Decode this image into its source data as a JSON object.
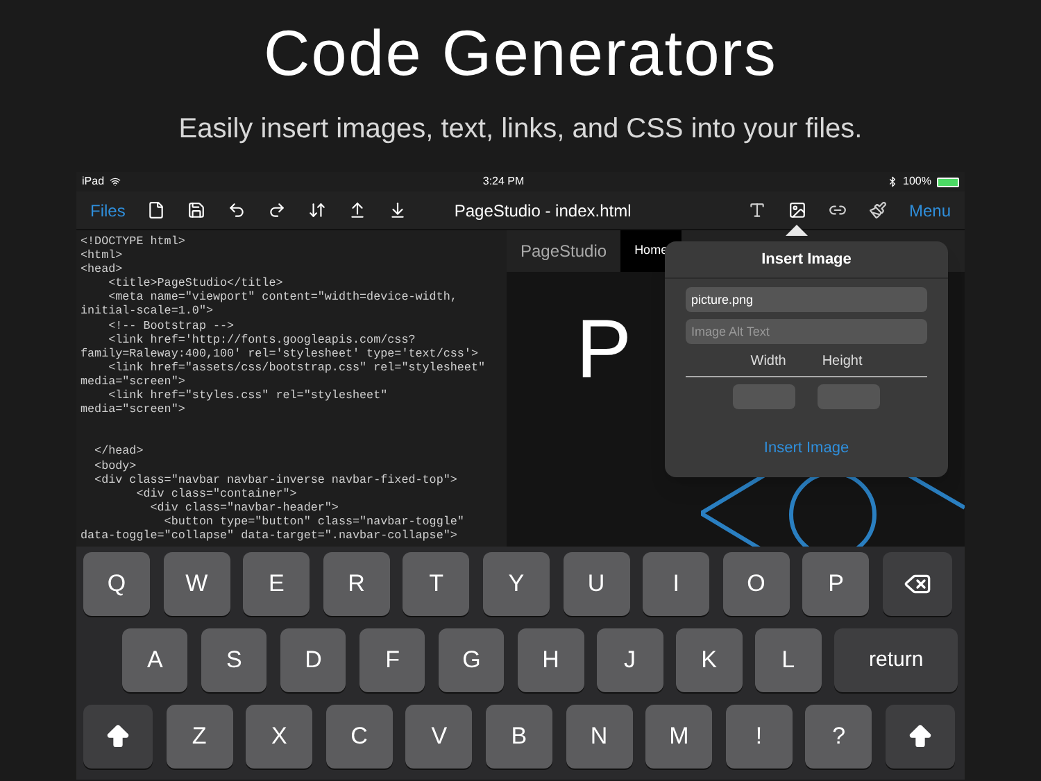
{
  "headline": "Code Generators",
  "subheadline": "Easily insert images, text, links, and CSS into your files.",
  "status_bar": {
    "device": "iPad",
    "time": "3:24 PM",
    "battery": "100%"
  },
  "toolbar": {
    "files": "Files",
    "title": "PageStudio - index.html",
    "menu": "Menu",
    "tools": [
      {
        "kind": "text",
        "selected": false
      },
      {
        "kind": "image",
        "selected": true
      },
      {
        "kind": "link",
        "selected": false
      },
      {
        "kind": "css",
        "selected": false
      }
    ]
  },
  "code_lines": [
    "<!DOCTYPE html>",
    "<html>",
    "<head>",
    "    <title>PageStudio</title>",
    "    <meta name=\"viewport\" content=\"width=device-width,",
    "initial-scale=1.0\">",
    "    <!-- Bootstrap -->",
    "    <link href='http://fonts.googleapis.com/css?",
    "family=Raleway:400,100' rel='stylesheet' type='text/css'>",
    "    <link href=\"assets/css/bootstrap.css\" rel=\"stylesheet\"",
    "media=\"screen\">",
    "    <link href=\"styles.css\" rel=\"stylesheet\"",
    "media=\"screen\">"
  ],
  "code_lines_after_gap": [
    "  </head>",
    "  <body>",
    "  <div class=\"navbar navbar-inverse navbar-fixed-top\">",
    "        <div class=\"container\">",
    "          <div class=\"navbar-header\">",
    "            <button type=\"button\" class=\"navbar-toggle\"",
    "data-toggle=\"collapse\" data-target=\".navbar-collapse\">"
  ],
  "preview": {
    "brand": "PageStudio",
    "nav_item": "Home",
    "heading_left": "P"
  },
  "popover": {
    "title": "Insert Image",
    "file_value": "picture.png",
    "alt_placeholder": "Image Alt Text",
    "width_label": "Width",
    "height_label": "Height",
    "action": "Insert Image"
  },
  "keyboard": [
    [
      {
        "kind": "letter",
        "label": "Q"
      },
      {
        "kind": "letter",
        "label": "W"
      },
      {
        "kind": "letter",
        "label": "E"
      },
      {
        "kind": "letter",
        "label": "R"
      },
      {
        "kind": "letter",
        "label": "T"
      },
      {
        "kind": "letter",
        "label": "Y"
      },
      {
        "kind": "letter",
        "label": "U"
      },
      {
        "kind": "letter",
        "label": "I"
      },
      {
        "kind": "letter",
        "label": "O"
      },
      {
        "kind": "letter",
        "label": "P"
      },
      {
        "kind": "backspace"
      }
    ],
    [
      {
        "kind": "letter",
        "label": "A"
      },
      {
        "kind": "letter",
        "label": "S"
      },
      {
        "kind": "letter",
        "label": "D"
      },
      {
        "kind": "letter",
        "label": "F"
      },
      {
        "kind": "letter",
        "label": "G"
      },
      {
        "kind": "letter",
        "label": "H"
      },
      {
        "kind": "letter",
        "label": "J"
      },
      {
        "kind": "letter",
        "label": "K"
      },
      {
        "kind": "letter",
        "label": "L"
      },
      {
        "kind": "return",
        "label": "return"
      }
    ],
    [
      {
        "kind": "shift"
      },
      {
        "kind": "letter",
        "label": "Z"
      },
      {
        "kind": "letter",
        "label": "X"
      },
      {
        "kind": "letter",
        "label": "C"
      },
      {
        "kind": "letter",
        "label": "V"
      },
      {
        "kind": "letter",
        "label": "B"
      },
      {
        "kind": "letter",
        "label": "N"
      },
      {
        "kind": "letter",
        "label": "M"
      },
      {
        "kind": "letter",
        "label": "!"
      },
      {
        "kind": "letter",
        "label": "?"
      },
      {
        "kind": "shift"
      }
    ]
  ]
}
